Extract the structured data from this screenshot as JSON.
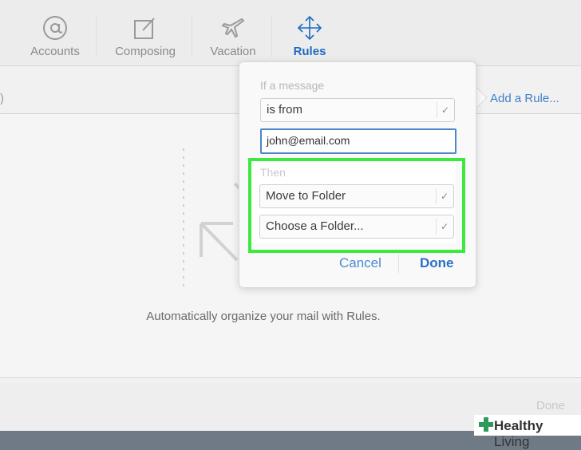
{
  "toolbar": {
    "tabs": [
      {
        "label": "Accounts",
        "icon": "at-sign-icon"
      },
      {
        "label": "Composing",
        "icon": "compose-icon"
      },
      {
        "label": "Vacation",
        "icon": "airplane-icon"
      },
      {
        "label": "Rules",
        "icon": "arrows-move-icon",
        "active": true
      }
    ]
  },
  "list_header": {
    "partial_text": ")"
  },
  "add_rule_link": "Add a Rule...",
  "empty_state": {
    "message": "Automatically organize your mail with Rules."
  },
  "footer": {
    "done_label": "Done"
  },
  "popover": {
    "condition_label": "If a message",
    "condition_select": "is from",
    "email_value": "john@email.com",
    "action_label": "Then",
    "action_select": "Move to Folder",
    "folder_select": "Choose a Folder...",
    "cancel_label": "Cancel",
    "done_label": "Done"
  },
  "watermark": {
    "bold": "Healthy",
    "regular": " Living"
  },
  "colors": {
    "accent": "#1f6bc1",
    "highlight": "#3ee83e",
    "link": "#3e7fc9"
  }
}
